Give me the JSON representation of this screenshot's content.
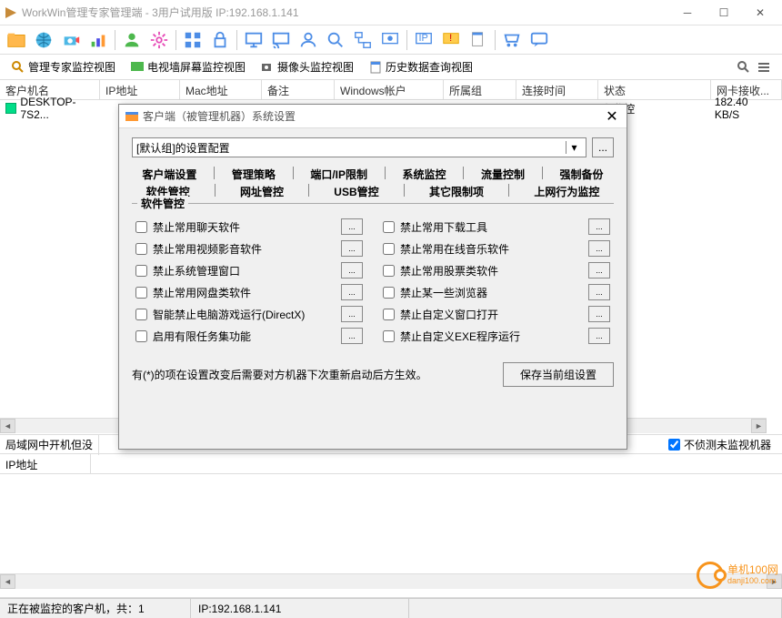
{
  "titlebar": {
    "text": "WorkWin管理专家管理端 - 3用户试用版 IP:192.168.1.141"
  },
  "sub_tabs": [
    {
      "label": "管理专家监控视图"
    },
    {
      "label": "电视墙屏幕监控视图"
    },
    {
      "label": "摄像头监控视图"
    },
    {
      "label": "历史数据查询视图"
    }
  ],
  "columns": {
    "client": "客户机名",
    "ip": "IP地址",
    "mac": "Mac地址",
    "remark": "备注",
    "winacct": "Windows帐户",
    "group": "所属组",
    "conntime": "连接时间",
    "status": "状态",
    "netcard": "网卡接收..."
  },
  "client": {
    "name": "DESKTOP-7S2...",
    "status": "在监控",
    "netrate": "182.40 KB/S"
  },
  "lan_header": "局域网中开机但没",
  "lan_check": "不侦测未监视机器",
  "ip_col": "IP地址",
  "statusbar": {
    "left": "正在被监控的客户机，共：1",
    "ip": "IP:192.168.1.141"
  },
  "dialog": {
    "title": "客户端（被管理机器）系统设置",
    "group_select": "[默认组]的设置配置",
    "tabs_row1": [
      "客户端设置",
      "管理策略",
      "端口/IP限制",
      "系统监控",
      "流量控制",
      "强制备份"
    ],
    "tabs_row2": [
      "软件管控",
      "网址管控",
      "USB管控",
      "其它限制项",
      "上网行为监控"
    ],
    "groupbox_title": "软件管控",
    "checks_left": [
      "禁止常用聊天软件",
      "禁止常用视频影音软件",
      "禁止系统管理窗口",
      "禁止常用网盘类软件",
      "智能禁止电脑游戏运行(DirectX)",
      "启用有限任务集功能"
    ],
    "checks_right": [
      "禁止常用下载工具",
      "禁止常用在线音乐软件",
      "禁止常用股票类软件",
      "禁止某一些浏览器",
      "禁止自定义窗口打开",
      "禁止自定义EXE程序运行"
    ],
    "footer_note": "有(*)的项在设置改变后需要对方机器下次重新启动后方生效。",
    "save_btn": "保存当前组设置"
  },
  "watermark": {
    "main": "单机100网",
    "sub": "danji100.com"
  }
}
